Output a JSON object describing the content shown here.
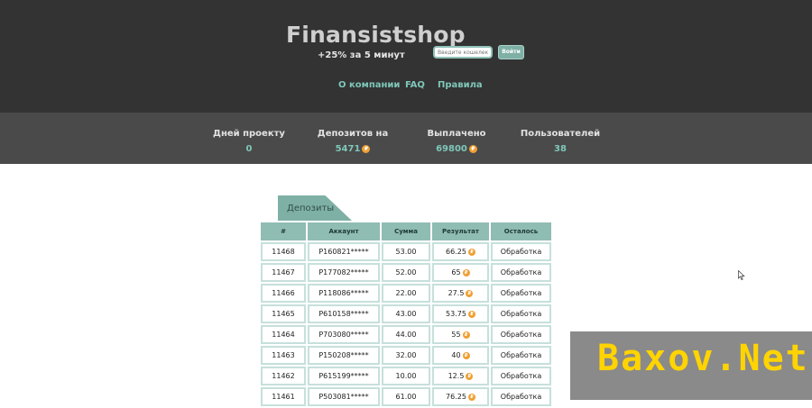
{
  "header": {
    "brand": "Finansistshop",
    "tagline": "+25% за 5 минут",
    "wallet_placeholder": "Введите кошелек",
    "login_label": "Войти",
    "nav": [
      "О компании",
      "FAQ",
      "Правила"
    ]
  },
  "stats": [
    {
      "label": "Дней проекту",
      "value": "0",
      "coin": false
    },
    {
      "label": "Депозитов на",
      "value": "5471",
      "coin": true
    },
    {
      "label": "Выплачено",
      "value": "69800",
      "coin": true
    },
    {
      "label": "Пользователей",
      "value": "38",
      "coin": false
    }
  ],
  "deposits": {
    "tab_label": "Депозиты",
    "columns": [
      "#",
      "Аккаунт",
      "Сумма",
      "Результат",
      "Осталось"
    ],
    "rows": [
      [
        "11468",
        "P160821*****",
        "53.00",
        "66.25",
        "Обработка"
      ],
      [
        "11467",
        "P177082*****",
        "52.00",
        "65",
        "Обработка"
      ],
      [
        "11466",
        "P118086*****",
        "22.00",
        "27.5",
        "Обработка"
      ],
      [
        "11465",
        "P610158*****",
        "43.00",
        "53.75",
        "Обработка"
      ],
      [
        "11464",
        "P703080*****",
        "44.00",
        "55",
        "Обработка"
      ],
      [
        "11463",
        "P150208*****",
        "32.00",
        "40",
        "Обработка"
      ],
      [
        "11462",
        "P615199*****",
        "10.00",
        "12.5",
        "Обработка"
      ],
      [
        "11461",
        "P503081*****",
        "61.00",
        "76.25",
        "Обработка"
      ]
    ]
  },
  "watermark": "Baxov.Net",
  "colors": {
    "header_bg": "#333333",
    "stats_bg": "#4a4a4a",
    "accent": "#7fc7b9",
    "table_header": "#8fbcb3",
    "coin": "#f0a033"
  }
}
